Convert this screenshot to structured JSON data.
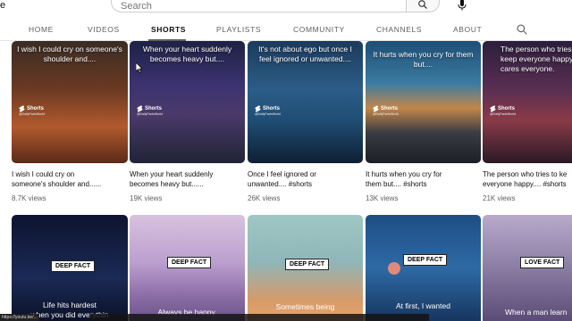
{
  "corner_text": "e",
  "search": {
    "placeholder": "Search"
  },
  "tabs": [
    {
      "label": "HOME"
    },
    {
      "label": "VIDEOS"
    },
    {
      "label": "SHORTS"
    },
    {
      "label": "PLAYLISTS"
    },
    {
      "label": "COMMUNITY"
    },
    {
      "label": "CHANNELS"
    },
    {
      "label": "ABOUT"
    }
  ],
  "active_tab": "SHORTS",
  "shorts_row1": [
    {
      "thumb_text": "I wish I could cry on someone's shoulder and....",
      "shorts_label": "Shorts",
      "channel": "@DailyFactsWorld",
      "title_line1": "I wish I could cry on",
      "title_line2": "someone's shoulder and......",
      "views": "8.7K views"
    },
    {
      "thumb_text": "When your heart suddenly becomes heavy but....",
      "shorts_label": "Shorts",
      "channel": "@DailyFactsWorld",
      "title_line1": "When your heart suddenly",
      "title_line2": "becomes heavy but......",
      "views": "19K views"
    },
    {
      "thumb_text": "It's not about ego but once I feel ignored or unwanted....",
      "shorts_label": "Shorts",
      "channel": "@DailyFactsWorld",
      "title_line1": "Once I feel ignored or",
      "title_line2": "unwanted.... #shorts",
      "views": "26K views"
    },
    {
      "thumb_text": "It hurts when you cry for them but....",
      "shorts_label": "Shorts",
      "channel": "@DailyFactsWorld",
      "title_line1": "It hurts when you cry for",
      "title_line2": "them but.... #shorts",
      "views": "13K views"
    },
    {
      "thumb_text": "The person who tries to keep everyone happy and cares everyone.",
      "shorts_label": "Shorts",
      "channel": "@DailyFactsWorld",
      "title_line1": "The person who tries to ke",
      "title_line2": "everyone happy.... #shorts",
      "views": "21K views"
    }
  ],
  "shorts_row2": [
    {
      "badge": "DEEP FACT",
      "bottom_text_1": "Life hits hardest",
      "bottom_text_2": "when you did everythin"
    },
    {
      "badge": "DEEP FACT",
      "bottom_text_1": "Always be happy,",
      "bottom_text_2": ""
    },
    {
      "badge": "DEEP FACT",
      "bottom_text_1": "Sometimes being",
      "bottom_text_2": ""
    },
    {
      "badge": "DEEP FACT",
      "bottom_text_1": "At first, I wanted",
      "bottom_text_2": ""
    },
    {
      "badge": "LOVE FACT",
      "bottom_text_1": "When a man learn",
      "bottom_text_2": ""
    }
  ],
  "status_strip": "https://youtu.be/...",
  "colors": {
    "accent_tab": "#606060",
    "text_primary": "#0f0f0f",
    "text_secondary": "#606060"
  }
}
